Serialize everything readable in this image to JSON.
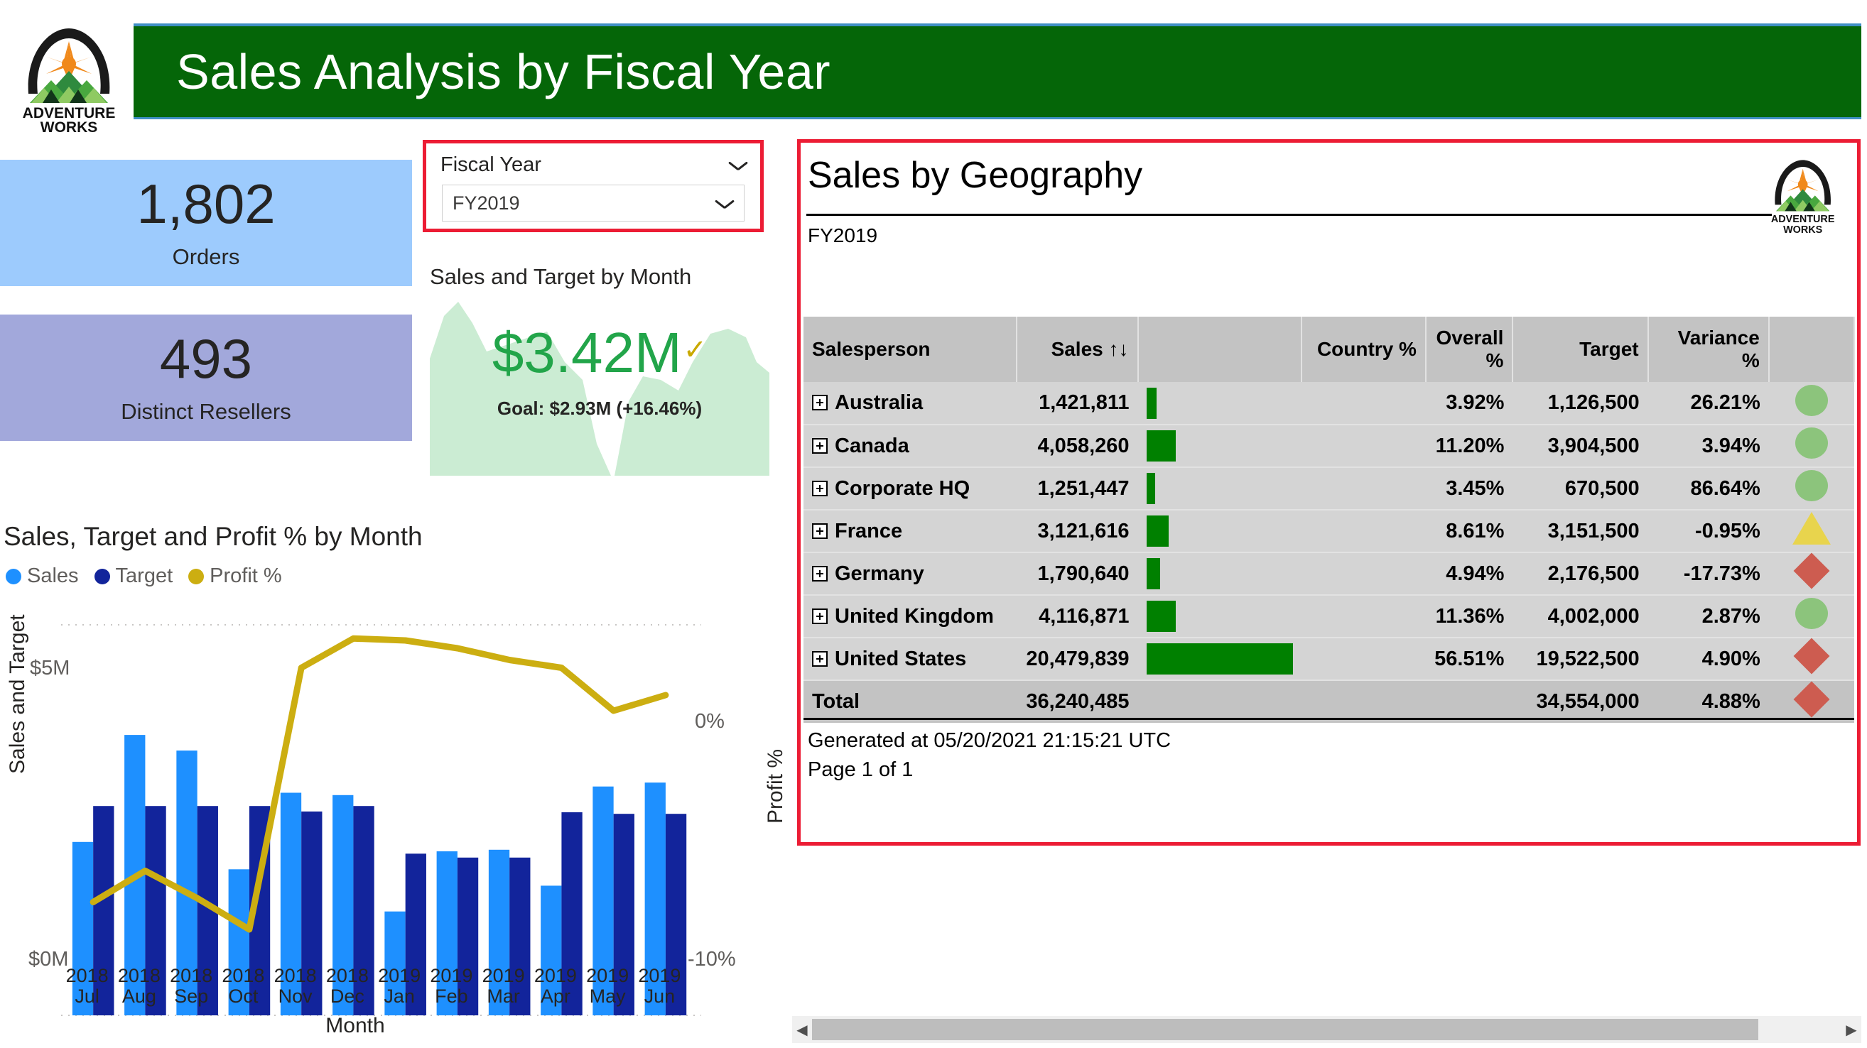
{
  "header": {
    "title": "Sales Analysis by Fiscal Year",
    "logo_name": "adventure-works-logo",
    "logo_text_top": "ADVENTURE",
    "logo_text_bottom": "WORKS",
    "bar_color": "#056608",
    "accent_color": "#3f8fc4"
  },
  "kpi_cards": [
    {
      "value": "1,802",
      "label": "Orders",
      "bg": "#9dcbfd"
    },
    {
      "value": "493",
      "label": "Distinct Resellers",
      "bg": "#a2a8db"
    }
  ],
  "slicer": {
    "label": "Fiscal Year",
    "value": "FY2019",
    "placeholder": "FY2019",
    "highlight_color": "#ec1c34",
    "chevron_icon": "chevron-down-icon"
  },
  "kpi_visual": {
    "title": "Sales and Target by Month",
    "value": "$3.42M",
    "status_icon": "check-icon",
    "goal_text": "Goal: $2.93M (+16.46%)",
    "value_color": "#22a54a",
    "area_color": "#cbecd3"
  },
  "chart_data": {
    "type": "bar",
    "title": "Sales, Target and Profit % by Month",
    "xlabel": "Month",
    "ylabel": "Sales and Target",
    "y2label": "Profit %",
    "categories": [
      "2018 Jul",
      "2018 Aug",
      "2018 Sep",
      "2018 Oct",
      "2018 Nov",
      "2018 Dec",
      "2019 Jan",
      "2019 Feb",
      "2019 Mar",
      "2019 Apr",
      "2019 May",
      "2019 Jun"
    ],
    "category_years": [
      "2018",
      "2018",
      "2018",
      "2018",
      "2018",
      "2018",
      "2019",
      "2019",
      "2019",
      "2019",
      "2019",
      "2019"
    ],
    "category_months": [
      "Jul",
      "Aug",
      "Sep",
      "Oct",
      "Nov",
      "Dec",
      "Jan",
      "Feb",
      "Mar",
      "Apr",
      "May",
      "Jun"
    ],
    "ylim": [
      0,
      5000000
    ],
    "y2lim": [
      -10,
      0
    ],
    "ytick_labels": [
      "$5M",
      "$0M"
    ],
    "y2tick_labels": [
      "0%",
      "-10%"
    ],
    "grid": true,
    "legend_position": "top-left",
    "series": [
      {
        "name": "Sales",
        "color": "#1e90ff",
        "type": "bar",
        "values": [
          2.22,
          3.59,
          3.39,
          1.87,
          2.85,
          2.82,
          1.33,
          2.1,
          2.12,
          1.66,
          2.93,
          2.98
        ]
      },
      {
        "name": "Target",
        "color": "#12249b",
        "type": "bar",
        "values": [
          2.68,
          2.68,
          2.68,
          2.68,
          2.61,
          2.68,
          2.07,
          2.02,
          2.02,
          2.6,
          2.58,
          2.58
        ]
      },
      {
        "name": "Profit %",
        "color": "#ccae11",
        "type": "line",
        "axis": "right",
        "values": [
          -7.1,
          -6.3,
          -7.0,
          -7.8,
          -1.1,
          -0.35,
          -0.4,
          -0.6,
          -0.9,
          -1.1,
          -2.2,
          -1.8
        ]
      }
    ]
  },
  "report": {
    "title": "Sales by Geography",
    "subtitle": "FY2019",
    "logo_name": "adventure-works-logo",
    "border_color": "#ec1c34",
    "sort_icon": "sort-arrows-icon",
    "expand_icon": "expand-plus-icon",
    "columns": [
      "Salesperson",
      "Sales",
      "",
      "Country %",
      "Overall %",
      "Target",
      "Variance %",
      ""
    ],
    "rows": [
      {
        "name": "Australia",
        "sales": "1,421,811",
        "bar_pct": 7,
        "country_pct": "",
        "overall_pct": "3.92%",
        "target": "1,126,500",
        "variance": "26.21%",
        "variance_neg": false,
        "indicator": "circle-green"
      },
      {
        "name": "Canada",
        "sales": "4,058,260",
        "bar_pct": 20,
        "country_pct": "",
        "overall_pct": "11.20%",
        "target": "3,904,500",
        "variance": "3.94%",
        "variance_neg": false,
        "indicator": "circle-green"
      },
      {
        "name": "Corporate HQ",
        "sales": "1,251,447",
        "bar_pct": 6,
        "country_pct": "",
        "overall_pct": "3.45%",
        "target": "670,500",
        "variance": "86.64%",
        "variance_neg": false,
        "indicator": "circle-green"
      },
      {
        "name": "France",
        "sales": "3,121,616",
        "bar_pct": 15,
        "country_pct": "",
        "overall_pct": "8.61%",
        "target": "3,151,500",
        "variance": "-0.95%",
        "variance_neg": true,
        "indicator": "triangle-yellow"
      },
      {
        "name": "Germany",
        "sales": "1,790,640",
        "bar_pct": 9,
        "country_pct": "",
        "overall_pct": "4.94%",
        "target": "2,176,500",
        "variance": "-17.73%",
        "variance_neg": true,
        "indicator": "diamond-red"
      },
      {
        "name": "United Kingdom",
        "sales": "4,116,871",
        "bar_pct": 20,
        "country_pct": "",
        "overall_pct": "11.36%",
        "target": "4,002,000",
        "variance": "2.87%",
        "variance_neg": false,
        "indicator": "circle-green"
      },
      {
        "name": "United States",
        "sales": "20,479,839",
        "bar_pct": 100,
        "country_pct": "",
        "overall_pct": "56.51%",
        "target": "19,522,500",
        "variance": "4.90%",
        "variance_neg": false,
        "indicator": "diamond-red"
      }
    ],
    "total": {
      "name": "Total",
      "sales": "36,240,485",
      "country_pct": "",
      "overall_pct": "",
      "target": "34,554,000",
      "variance": "4.88%",
      "variance_neg": false,
      "indicator": "diamond-red"
    },
    "footer_generated": "Generated at 05/20/2021 21:15:21 UTC",
    "footer_page": "Page 1 of 1"
  },
  "scrollbar": {
    "left_arrow_icon": "chevron-left-icon",
    "right_arrow_icon": "chevron-right-icon"
  }
}
